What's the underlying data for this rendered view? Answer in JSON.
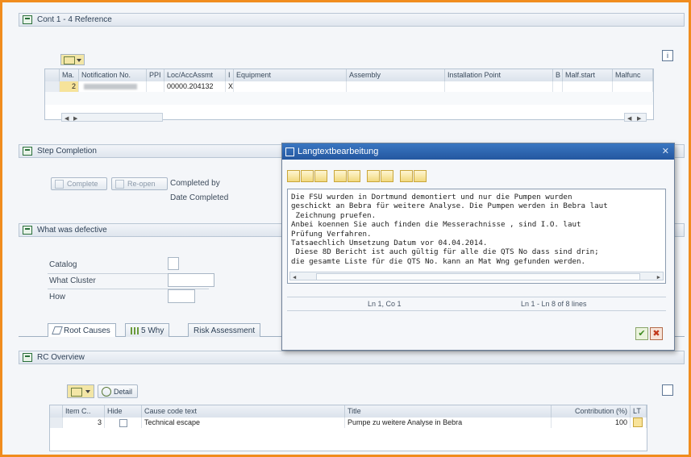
{
  "sections": {
    "reference": {
      "title": "Cont 1 - 4 Reference"
    },
    "step_completion": {
      "title": "Step Completion"
    },
    "what_defective": {
      "title": "What was defective"
    },
    "rc_overview": {
      "title": "RC Overview"
    }
  },
  "reference_table": {
    "headers": [
      "Ma.",
      "Notification No.",
      "PPI",
      "Loc/AccAssmt",
      "I",
      "Equipment",
      "Assembly",
      "Installation Point",
      "B",
      "Malf.start",
      "Malfunc"
    ],
    "row": {
      "ma": "2",
      "loc": "00000.204132",
      "i": "X"
    }
  },
  "step_completion": {
    "complete_btn": "Complete",
    "reopen_btn": "Re-open",
    "completed_by": "Completed by",
    "date_completed": "Date Completed"
  },
  "what_defective": {
    "catalog": "Catalog",
    "cluster": "What Cluster",
    "how": "How"
  },
  "tabs": [
    "Root Causes",
    "5 Why",
    "Risk Assessment"
  ],
  "rc_table": {
    "detail_btn": "Detail",
    "headers": [
      "Item C..",
      "Hide",
      "Cause code text",
      "Title",
      "Contribution (%)",
      "LT"
    ],
    "row": {
      "item": "3",
      "cause": "Technical escape",
      "title": "Pumpe zu weitere Analyse in Bebra",
      "contribution": "100"
    }
  },
  "dialog": {
    "title": "Langtextbearbeitung",
    "lines": [
      "Die FSU wurden in Dortmund demontiert und nur die Pumpen wurden",
      "geschickt an Bebra für weitere Analyse. Die Pumpen werden in Bebra laut",
      " Zeichnung pruefen.",
      "Anbei koennen Sie auch finden die Messerachnisse , sind I.O. laut",
      "Prüfung Verfahren.",
      "Tatsaechlich Umsetzung Datum vor 04.04.2014.",
      " Diese 8D Bericht ist auch gültig für alle die QTS No dass sind drin;",
      "die gesamte Liste für die QTS No. kann an Mat Wng gefunden werden."
    ],
    "cursor_pos": "Ln 1, Co 1",
    "line_info": "Ln 1 - Ln 8 of 8 lines"
  }
}
